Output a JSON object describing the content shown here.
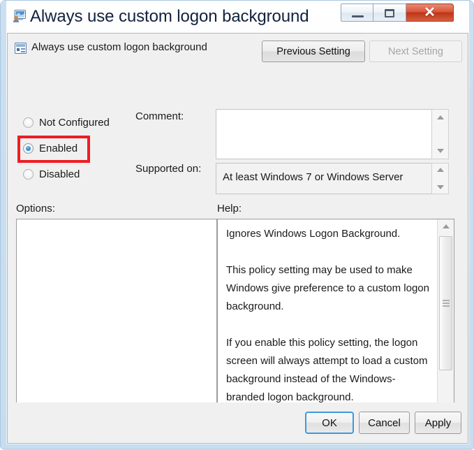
{
  "window": {
    "title": "Always use custom logon background",
    "icon": "logon-screen-user-icon",
    "controls": {
      "minimize": "minimize-icon",
      "maximize": "maximize-icon",
      "close_glyph": "✕"
    }
  },
  "header": {
    "policy_icon": "group-policy-setting-icon",
    "policy_name": "Always use custom logon background",
    "previous_setting_label": "Previous Setting",
    "next_setting_label": "Next Setting",
    "next_setting_disabled": true
  },
  "state_options": [
    {
      "label": "Not Configured",
      "selected": false
    },
    {
      "label": "Enabled",
      "selected": true
    },
    {
      "label": "Disabled",
      "selected": false
    }
  ],
  "highlight": {
    "target": "Enabled",
    "color": "#ee1d23"
  },
  "fields": {
    "comment_label": "Comment:",
    "comment_value": "",
    "supported_label": "Supported on:",
    "supported_value": "At least Windows 7 or Windows Server"
  },
  "panels": {
    "options_label": "Options:",
    "options_content": "",
    "help_label": "Help:",
    "help_text": "Ignores Windows Logon Background.\n\nThis policy setting may be used to make Windows give preference to a custom logon background.\n\nIf you enable this policy setting, the logon screen will always attempt to load a custom background instead of the Windows-branded logon background.\n\nIf you disable or do not configure this"
  },
  "footer": {
    "ok_label": "OK",
    "cancel_label": "Cancel",
    "apply_label": "Apply"
  },
  "colors": {
    "dialog_bg": "#f0f0f0",
    "accent_focus": "#3c9ade",
    "close_button": "#c0391a",
    "highlight_red": "#ee1d23"
  }
}
